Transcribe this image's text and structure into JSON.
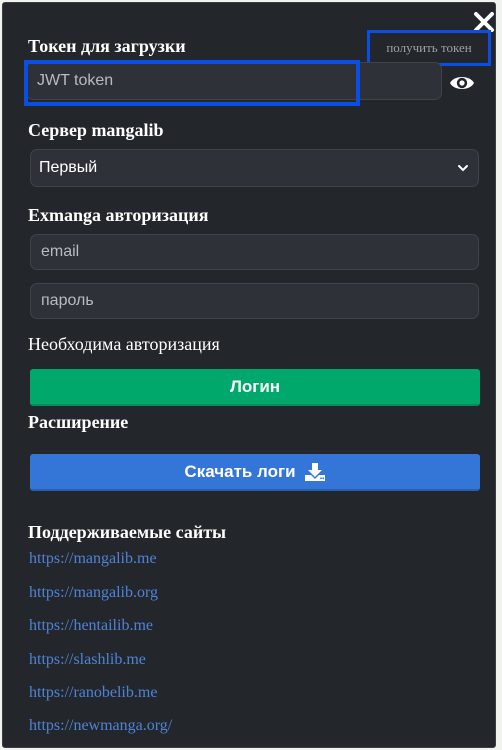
{
  "token": {
    "title": "Токен для загрузки",
    "get_token_label": "получить токен",
    "placeholder": "JWT token",
    "show_icon": "eye-icon"
  },
  "server": {
    "title": "Сервер mangalib",
    "selected": "Первый"
  },
  "exmanga": {
    "title": "Exmanga авторизация",
    "email_placeholder": "email",
    "password_placeholder": "пароль"
  },
  "auth_required_text": "Необходима авторизация",
  "login_button": "Логин",
  "extension": {
    "title": "Расширение",
    "download_logs_button": "Скачать логи",
    "download_icon": "download-icon"
  },
  "supported": {
    "title": "Поддерживаемые сайты",
    "links": [
      "https://mangalib.me",
      "https://mangalib.org",
      "https://hentailib.me",
      "https://slashlib.me",
      "https://ranobelib.me",
      "https://newmanga.org/"
    ]
  },
  "colors": {
    "panel_bg": "#23262b",
    "field_bg": "#2e3238",
    "login_green": "#00a86b",
    "logs_blue": "#3475d8",
    "link_blue": "#4f83d8",
    "highlight_blue": "#0a4ee6"
  }
}
